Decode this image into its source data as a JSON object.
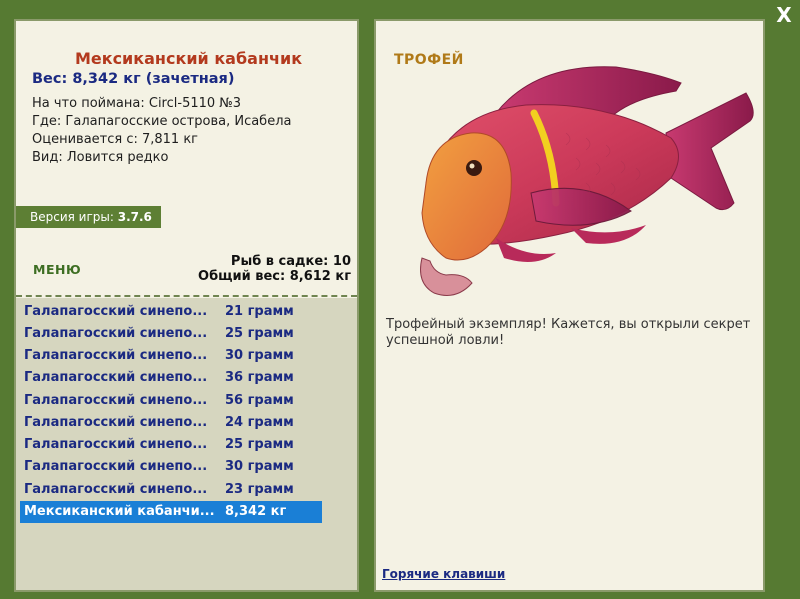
{
  "window": {
    "close_label": "X"
  },
  "fish": {
    "name": "Мексиканский кабанчик",
    "weight_line": "Вес: 8,342 кг (зачетная)",
    "caught_on": "На что поймана: Circl-5110 №3",
    "location": "Где: Галапагосские острова, Исабела",
    "rated_from": "Оценивается с: 7,811 кг",
    "rarity": "Вид: Ловится редко"
  },
  "version": {
    "label": "Версия игры:",
    "value": "3.7.6"
  },
  "menu": {
    "label": "МЕНЮ"
  },
  "cage": {
    "count_label": "Рыб в садке: 10",
    "total_label": "Общий вес: 8,612 кг"
  },
  "catch_list": [
    {
      "name": "Галапагосский синепо...",
      "weight": "21 грамм"
    },
    {
      "name": "Галапагосский синепо...",
      "weight": "25 грамм"
    },
    {
      "name": "Галапагосский синепо...",
      "weight": "30 грамм"
    },
    {
      "name": "Галапагосский синепо...",
      "weight": "36 грамм"
    },
    {
      "name": "Галапагосский синепо...",
      "weight": "56 грамм"
    },
    {
      "name": "Галапагосский синепо...",
      "weight": "24 грамм"
    },
    {
      "name": "Галапагосский синепо...",
      "weight": "25 грамм"
    },
    {
      "name": "Галапагосский синепо...",
      "weight": "30 грамм"
    },
    {
      "name": "Галапагосский синепо...",
      "weight": "23 грамм"
    },
    {
      "name": "Мексиканский кабанчи...",
      "weight": "8,342 кг"
    }
  ],
  "trophy": {
    "label": "ТРОФЕЙ",
    "text": "Трофейный экземпляр! Кажется, вы открыли секрет успешной ловли!"
  },
  "footer": {
    "hotkeys_label": "Горячие клавиши"
  },
  "colors": {
    "background": "#567a32",
    "selected_row": "#1a7fd6",
    "fish_name": "#b33a1e",
    "link_blue": "#1b2a82"
  }
}
